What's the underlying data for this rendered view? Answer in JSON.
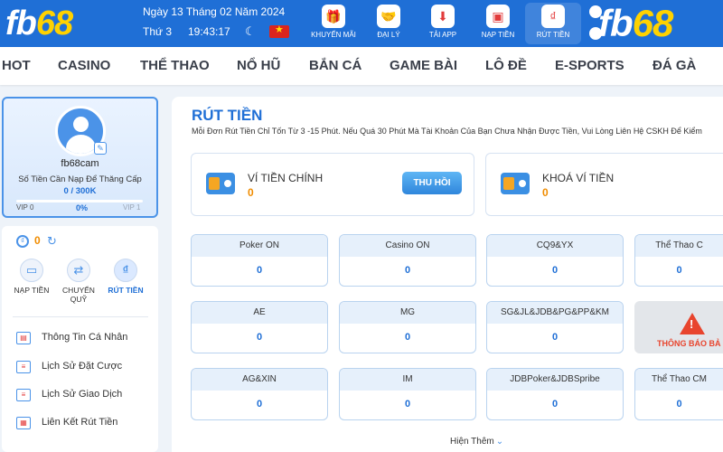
{
  "brand": {
    "logo_main": "fb",
    "logo_accent": "68"
  },
  "header": {
    "date": "Ngày 13 Tháng 02 Năm 2024",
    "weekday": "Thứ 3",
    "time": "19:43:17",
    "nav": [
      {
        "label": "KHUYẾN MÃI",
        "icon": "gift-icon"
      },
      {
        "label": "ĐẠI LÝ",
        "icon": "handshake-icon"
      },
      {
        "label": "TẢI APP",
        "icon": "download-app-icon"
      },
      {
        "label": "NẠP TIỀN",
        "icon": "wallet-icon"
      },
      {
        "label": "RÚT TIỀN",
        "icon": "money-bag-icon"
      }
    ]
  },
  "categories": [
    "HOT",
    "CASINO",
    "THỂ THAO",
    "NỔ HŨ",
    "BẮN CÁ",
    "GAME BÀI",
    "LÔ ĐỀ",
    "E-SPORTS",
    "ĐÁ GÀ"
  ],
  "profile": {
    "username": "fb68cam",
    "upgrade_label": "Số Tiền Cần Nạp Để Thăng Cấp",
    "upgrade_value": "0 / 300K",
    "vip_current": "VIP 0",
    "vip_progress": "0%",
    "vip_next": "VIP 1"
  },
  "sidebar": {
    "balance": "0",
    "quick_actions": [
      "NẠP TIỀN",
      "CHUYỂN QUỸ",
      "RÚT TIỀN"
    ],
    "menu": [
      "Thông Tin Cá Nhân",
      "Lịch Sử Đặt Cược",
      "Lịch Sử Giao Dịch",
      "Liên Kết Rút Tiền"
    ]
  },
  "main": {
    "title": "RÚT TIỀN",
    "notice": "Mỗi Đơn Rút Tiền Chỉ Tốn Từ 3 -15 Phút. Nếu Quá 30 Phút Mà Tài Khoản Của Bạn Chưa Nhận Được Tiền, Vui Lòng Liên Hệ CSKH Để Kiểm",
    "wallets": [
      {
        "name": "VÍ TIỀN CHÍNH",
        "value": "0",
        "button": "THU HỒI"
      },
      {
        "name": "KHOÁ VÍ TIỀN",
        "value": "0"
      }
    ],
    "games": [
      {
        "name": "Poker ON",
        "value": "0"
      },
      {
        "name": "Casino ON",
        "value": "0"
      },
      {
        "name": "CQ9&YX",
        "value": "0"
      },
      {
        "name": "Thể Thao C",
        "value": "0"
      },
      {
        "name": "AE",
        "value": "0"
      },
      {
        "name": "MG",
        "value": "0"
      },
      {
        "name": "SG&JL&JDB&PG&PP&KM",
        "value": "0"
      },
      {
        "name": "AG&XIN",
        "value": "0"
      },
      {
        "name": "IM",
        "value": "0"
      },
      {
        "name": "JDBPoker&JDBSpribe",
        "value": "0"
      },
      {
        "name": "Thể Thao CM",
        "value": "0"
      }
    ],
    "maintenance_label": "THÔNG BÁO BẢ",
    "show_more": "Hiện Thêm"
  }
}
